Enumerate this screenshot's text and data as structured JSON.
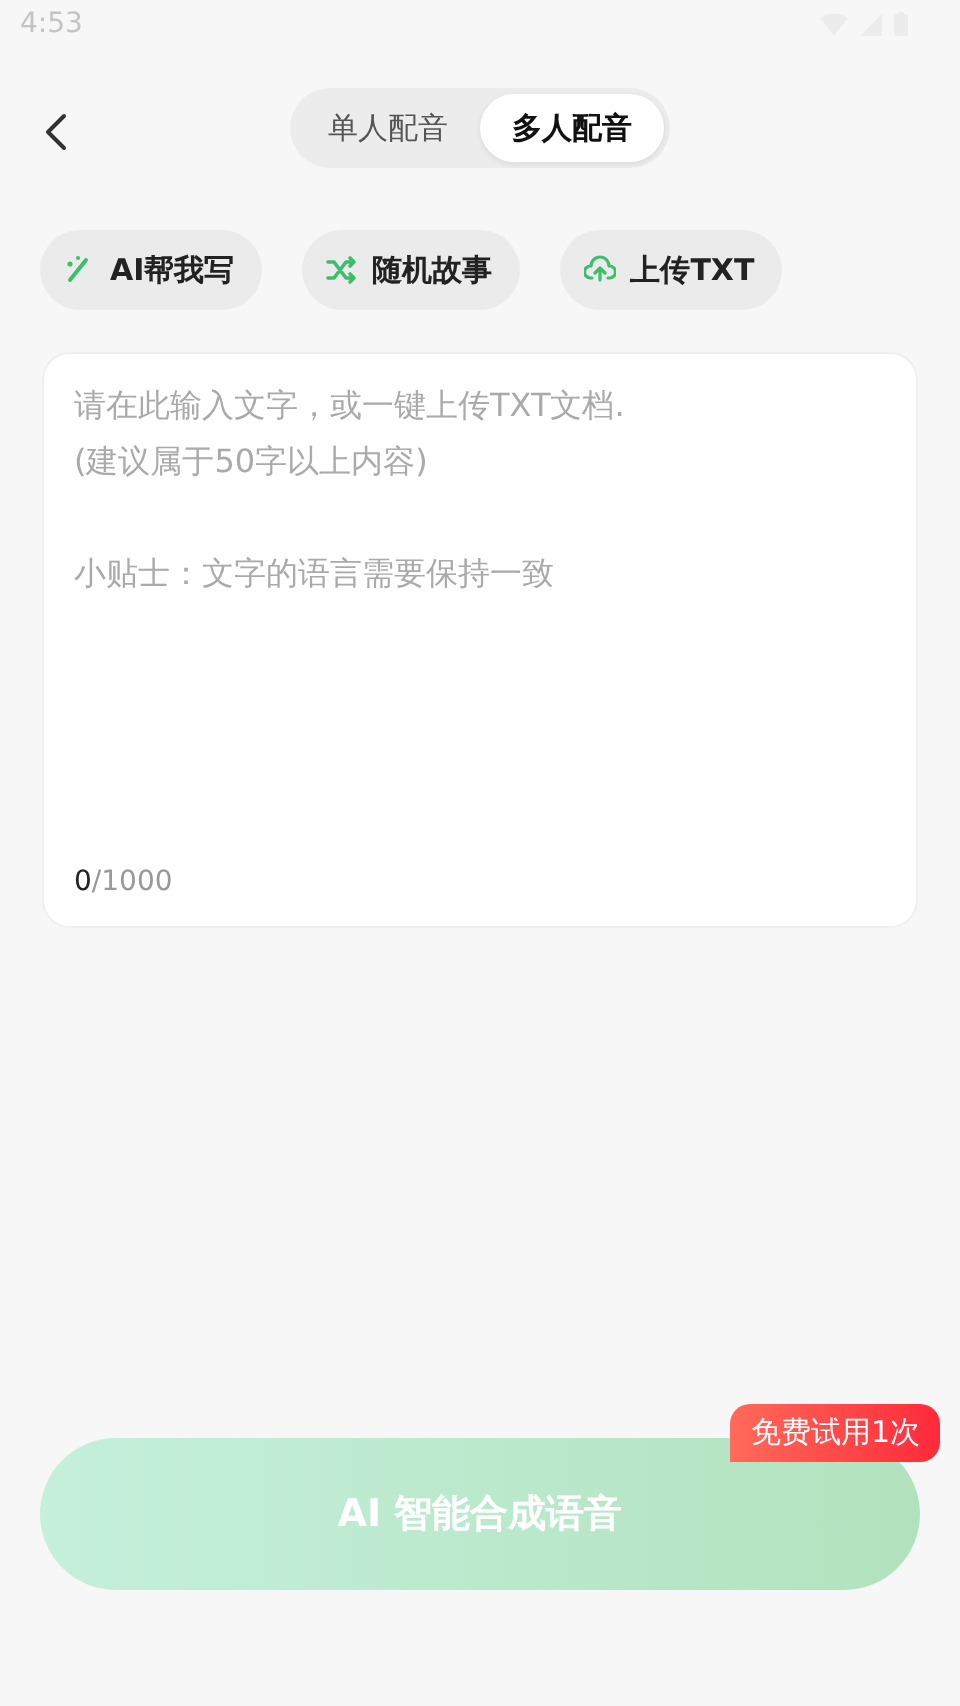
{
  "status_bar": {
    "time": "4:53"
  },
  "header": {
    "tabs": [
      {
        "label": "单人配音",
        "selected": false
      },
      {
        "label": "多人配音",
        "selected": true
      }
    ]
  },
  "actions": [
    {
      "kind": "ai",
      "label": "AI帮我写"
    },
    {
      "kind": "shuffle",
      "label": "随机故事"
    },
    {
      "kind": "upload",
      "label": "上传TXT"
    }
  ],
  "editor": {
    "placeholder": "请在此输入文字，或一键上传TXT文档.\n(建议属于50字以上内容)\n\n小贴士：文字的语言需要保持一致",
    "count": "0",
    "limit": "/1000"
  },
  "generate": {
    "label": "AI 智能合成语音",
    "badge": "免费试用1次"
  }
}
